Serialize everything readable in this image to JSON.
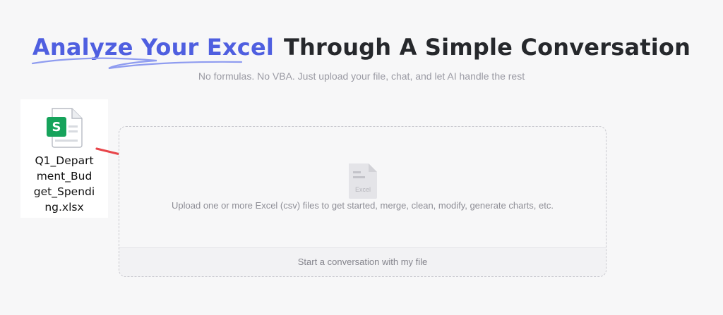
{
  "hero": {
    "title_accent": "Analyze Your Excel",
    "title_rest": "Through A Simple Conversation",
    "subtitle": "No formulas. No VBA. Just upload your file, chat, and let AI handle the rest"
  },
  "file_card": {
    "icon": "spreadsheet-file-icon",
    "icon_letter": "S",
    "filename": "Q1_Department_Budget_Spending.xlsx"
  },
  "dropzone": {
    "icon": "excel-file-icon",
    "icon_label": "Excel",
    "hint": "Upload one or more Excel (csv) files to get started, merge, clean, modify, generate charts, etc.",
    "start_label": "Start a conversation with my file"
  },
  "colors": {
    "accent": "#4f5fe0",
    "arrow": "#e8454a",
    "spreadsheet_green": "#16a35b"
  }
}
